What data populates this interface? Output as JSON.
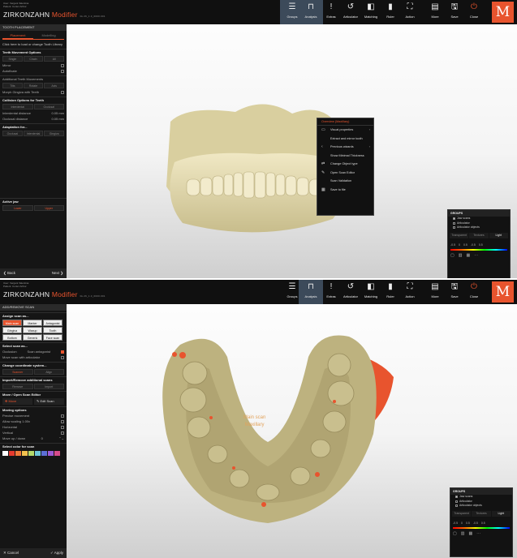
{
  "app": {
    "brand": "ZIRKONZAHN",
    "brand_accent": "Modifier",
    "build": "bk.26_1.3_0000.001",
    "user": "User: Vergani Valentina",
    "patient": "Patient: Cortez Arthur",
    "logo": "M",
    "accent_color": "#e8542e"
  },
  "toolbar": {
    "groups": "Groups",
    "analysis": "Analysis",
    "extras": "Extras",
    "articulator": "Articulator",
    "matching": "Matching",
    "ruler": "Ruler",
    "action": "Action",
    "more": "More",
    "save": "Save",
    "close": "Close"
  },
  "panel1": {
    "title": "TOOTH PLACEMENT",
    "tabs": [
      "Placement",
      "Modelling"
    ],
    "hint": "Click here to load or change Tooth Library",
    "movement_title": "Teeth Movement Options",
    "movement_modes": [
      "Single",
      "Chain",
      "All"
    ],
    "mirror": "Mirror",
    "autofixate": "Autofixate",
    "additional_title": "Additional Teeth Movements",
    "additional_modes": [
      "Tilts",
      "Rotate",
      "Axis"
    ],
    "morph": "Morph Gingiva with Teeth",
    "collision_title": "Collision Options for Teeth",
    "collision_modes": [
      "Interdental",
      "Occlusal"
    ],
    "interdental": "Interdental distance",
    "interdental_val": "0.05 mm",
    "occlusal": "Occlusal distance",
    "occlusal_val": "0.05 mm",
    "adaptation_title": "Adaptation for...",
    "adaptation_modes": [
      "Occlusal",
      "Interdental",
      "Gingiva"
    ],
    "jaw_title": "Active jaw",
    "jaw_modes": [
      "Lower",
      "Upper"
    ],
    "back": "Back",
    "next": "Next"
  },
  "context": {
    "header": "Overview (Maxillary)",
    "items": [
      "Visual properties",
      "Extract and mirror tooth",
      "Previous wizards",
      "Show Minimal Thickness",
      "Change Object type",
      "Open Scan Editor",
      "Scan Validation",
      "Save to file"
    ]
  },
  "groups1": {
    "title": "GROUPS",
    "items": [
      "Jaw scans",
      "Articulator",
      "Articulator objects"
    ],
    "tabs": [
      "Transparent",
      "Textures",
      "Light"
    ],
    "range": [
      "-0.5",
      "0",
      "0.5",
      "-0.5",
      "0.5"
    ]
  },
  "panel2": {
    "title": "ADD/REMOVE SCAN",
    "assign_title": "Assign scan as...",
    "assign_row1": [
      "Main scan",
      "Marker",
      "Antagonist"
    ],
    "assign_row2": [
      "Gingiva",
      "Waxup",
      "Tooth"
    ],
    "assign_row3": [
      "Bottom",
      "Generic",
      "Face scan"
    ],
    "select_title": "Select scan as...",
    "occlusion": "Occlusion",
    "scan_antagonist": "Scan antagonist",
    "move_scan": "Move scan with articulator",
    "coord_title": "Change coordinate system...",
    "coord_modes": [
      "Scanner",
      "Align"
    ],
    "import_title": "Import/Remove additional scans",
    "import_modes": [
      "Remove",
      "Import"
    ],
    "move_title": "Move / Open Scan Editor",
    "move_btn": "Move",
    "edit_btn": "Edit Scan",
    "moving_title": "Moving options",
    "precise": "Precise movement",
    "allow_scaling": "Allow scaling 1.00x",
    "horizontal": "Horizontal",
    "vertical": "Vertical",
    "move_updown": "Move up / down",
    "move_val": "0",
    "color_title": "Select color for scan",
    "swatches": [
      "#ffffff",
      "#e63a2e",
      "#f07a3a",
      "#f2c14e",
      "#b4d96a",
      "#6ec6d8",
      "#5c6fd6",
      "#9c5ad6",
      "#d64c8c"
    ],
    "cancel": "Cancel",
    "apply": "Apply"
  },
  "model2_label": [
    "Main scan",
    "Maxillary"
  ],
  "groups2": {
    "title": "GROUPS",
    "items": [
      "Jaw scans",
      "Articulator",
      "Articulator objects"
    ],
    "tabs": [
      "Transparent",
      "Textures",
      "Light"
    ],
    "range": [
      "-0.5",
      "0",
      "0.5",
      "-0.5",
      "0.5"
    ]
  }
}
